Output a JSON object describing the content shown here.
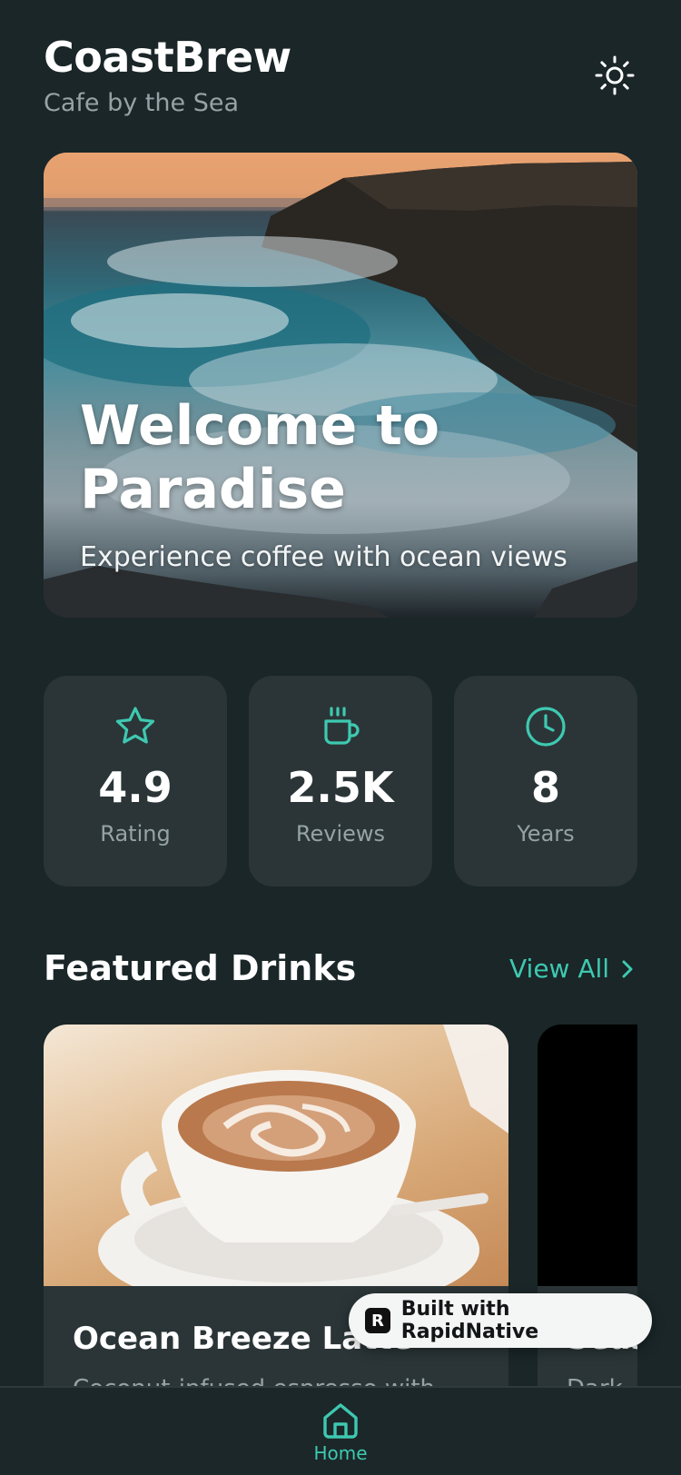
{
  "header": {
    "title": "CoastBrew",
    "subtitle": "Cafe by the Sea",
    "theme_icon": "sun-icon"
  },
  "hero": {
    "title": "Welcome to Paradise",
    "subtitle": "Experience coffee with ocean views"
  },
  "stats": [
    {
      "icon": "star-icon",
      "value": "4.9",
      "label": "Rating"
    },
    {
      "icon": "coffee-cup-icon",
      "value": "2.5K",
      "label": "Reviews"
    },
    {
      "icon": "clock-icon",
      "value": "8",
      "label": "Years"
    }
  ],
  "featured": {
    "title": "Featured Drinks",
    "view_all": "View All",
    "drinks": [
      {
        "name": "Ocean Breeze Latte",
        "description": "Coconut-infused espresso with"
      },
      {
        "name": "Seas",
        "description": "Dark"
      }
    ]
  },
  "badge": {
    "text": "Built with RapidNative",
    "logo_letter": "R"
  },
  "bottom_nav": {
    "tabs": [
      {
        "label": "Home",
        "icon": "home-icon",
        "active": true
      }
    ]
  },
  "colors": {
    "background": "#1a2628",
    "card": "#2b3537",
    "accent": "#3ec9b1",
    "muted_text": "#95a3a6"
  }
}
